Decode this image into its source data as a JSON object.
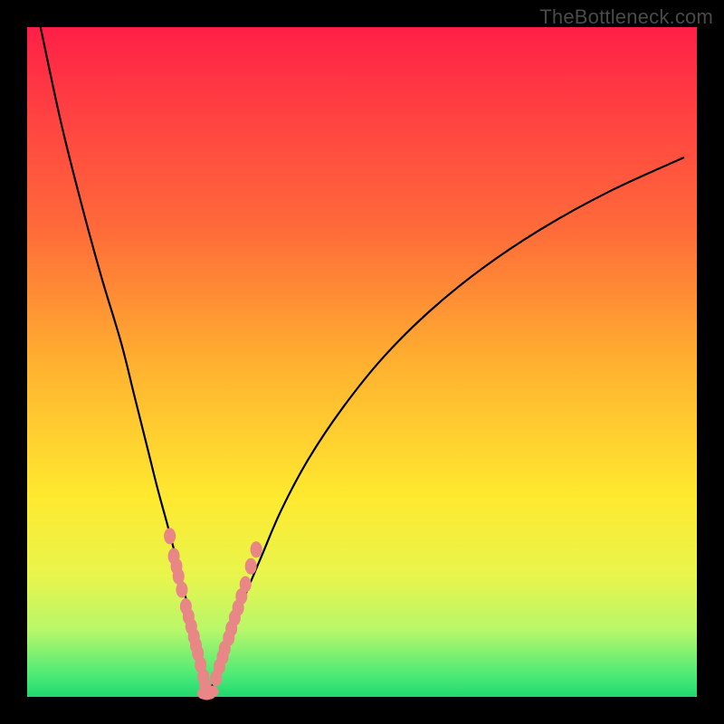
{
  "watermark": "TheBottleneck.com",
  "colors": {
    "frame": "#000000",
    "gradient_top": "#ff1f47",
    "gradient_mid": "#ffe92f",
    "gradient_bottom": "#1fd86e",
    "curve": "#000000",
    "bead": "#e98686"
  },
  "chart_data": {
    "type": "line",
    "title": "",
    "xlabel": "",
    "ylabel": "",
    "xlim": [
      0,
      100
    ],
    "ylim": [
      0,
      100
    ],
    "grid": false,
    "legend": false,
    "annotations": [
      "TheBottleneck.com"
    ],
    "curve_left": {
      "x": [
        2,
        5,
        8,
        11,
        14,
        16,
        18,
        19.5,
        21,
        22.3,
        23.4,
        24.3,
        25,
        25.6,
        26.1,
        26.5,
        26.8
      ],
      "y": [
        100,
        86,
        74,
        63,
        53,
        45,
        37,
        31,
        25.5,
        20.5,
        16,
        12,
        8.8,
        6,
        3.6,
        1.7,
        0.5
      ]
    },
    "curve_right": {
      "x": [
        26.8,
        27.8,
        29,
        30.5,
        32.5,
        35,
        38,
        42,
        47,
        53,
        60,
        68,
        77,
        87,
        98
      ],
      "y": [
        0.5,
        2,
        5,
        9.5,
        15,
        21,
        28,
        35.5,
        43,
        50.5,
        57.5,
        64,
        70,
        75.5,
        80.5
      ]
    },
    "beads_left": {
      "x": [
        21.3,
        21.9,
        22.3,
        22.6,
        23.1,
        23.7,
        24.1,
        24.5,
        24.9,
        25.2,
        25.5,
        25.9,
        26.3,
        26.6
      ],
      "y": [
        24,
        21,
        19.5,
        18,
        16,
        13.5,
        12,
        10.5,
        9,
        7.7,
        6.5,
        4.8,
        3,
        1.6
      ]
    },
    "beads_bottom": {
      "x": [
        26.4,
        26.8,
        27.2,
        27.6
      ],
      "y": [
        0.5,
        0.4,
        0.5,
        0.8
      ]
    },
    "beads_right": {
      "x": [
        28.2,
        28.7,
        29.2,
        29.5,
        30.1,
        30.5,
        31.0,
        31.5,
        32.0,
        32.6,
        33.4,
        34.2
      ],
      "y": [
        2.8,
        4.5,
        6.0,
        7.2,
        8.8,
        10.2,
        11.8,
        13.3,
        15.0,
        16.8,
        19.5,
        22.0
      ]
    }
  }
}
